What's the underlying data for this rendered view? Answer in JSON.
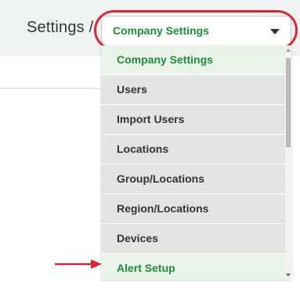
{
  "breadcrumb": {
    "parent": "Settings /"
  },
  "select": {
    "value": "Company Settings"
  },
  "dropdown": {
    "items": [
      "Company Settings",
      "Users",
      "Import Users",
      "Locations",
      "Group/Locations",
      "Region/Locations",
      "Devices",
      "Alert Setup"
    ]
  },
  "colors": {
    "accent_green": "#1f8a3b",
    "annotation_red": "#d6283a"
  },
  "icons": {
    "caret": "chevron-down-icon",
    "arrow": "red-arrow-right-icon"
  }
}
